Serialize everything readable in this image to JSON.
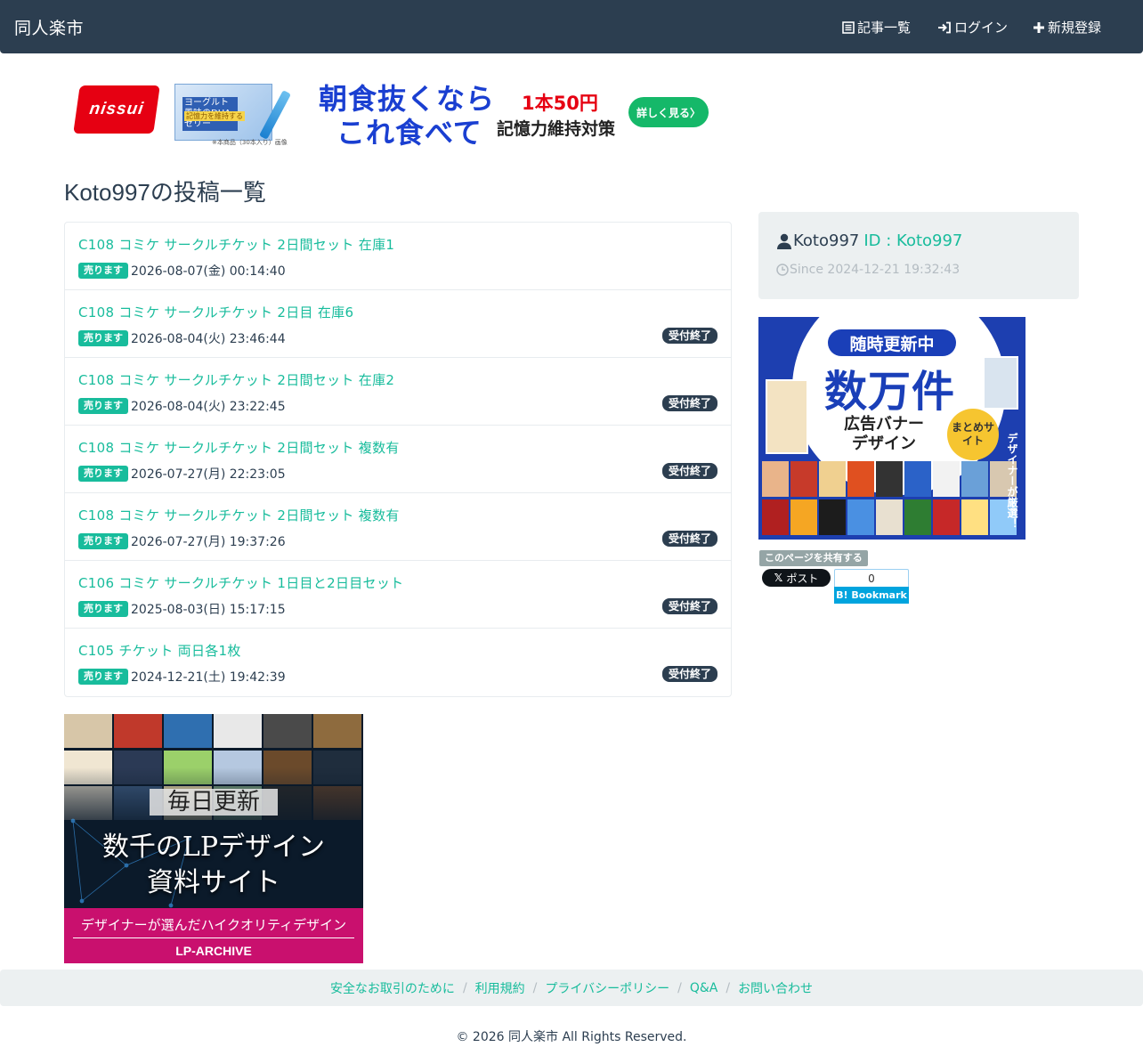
{
  "navbar": {
    "brand": "同人楽市",
    "items": [
      {
        "label": "記事一覧",
        "icon": "list-icon"
      },
      {
        "label": "ログイン",
        "icon": "login-icon"
      },
      {
        "label": "新規登録",
        "icon": "plus-icon"
      }
    ]
  },
  "top_ad": {
    "logo": "nissui",
    "product_label": "ヨーグルト風味のDHAゼリー",
    "product_sub": "記憶力を維持する",
    "product_note": "※本商品（30本入り）画像",
    "headline_line1": "朝食抜くなら",
    "headline_line2": "これ食べて",
    "price": "1本50円",
    "subline": "記憶力維持対策",
    "button": "詳しく見る〉"
  },
  "page_title": "Koto997の投稿一覧",
  "posts": [
    {
      "title": "C108 コミケ サークルチケット 2日間セット 在庫1",
      "type": "売ります",
      "date": "2026-08-07(金) 00:14:40",
      "status": ""
    },
    {
      "title": "C108 コミケ サークルチケット 2日目 在庫6",
      "type": "売ります",
      "date": "2026-08-04(火) 23:46:44",
      "status": "受付終了"
    },
    {
      "title": "C108 コミケ サークルチケット 2日間セット 在庫2",
      "type": "売ります",
      "date": "2026-08-04(火) 23:22:45",
      "status": "受付終了"
    },
    {
      "title": "C108 コミケ サークルチケット 2日間セット 複数有",
      "type": "売ります",
      "date": "2026-07-27(月) 22:23:05",
      "status": "受付終了"
    },
    {
      "title": "C108 コミケ サークルチケット 2日間セット 複数有",
      "type": "売ります",
      "date": "2026-07-27(月) 19:37:26",
      "status": "受付終了"
    },
    {
      "title": "C106 コミケ サークルチケット 1日目と2日目セット",
      "type": "売ります",
      "date": "2025-08-03(日) 15:17:15",
      "status": "受付終了"
    },
    {
      "title": "C105 チケット 両日各1枚",
      "type": "売ります",
      "date": "2024-12-21(土) 19:42:39",
      "status": "受付終了"
    }
  ],
  "profile": {
    "name": "Koto997",
    "id_label": "ID : Koto997",
    "since": "Since 2024-12-21 19:32:43"
  },
  "side_ad": {
    "pill": "随時更新中",
    "big": "数万件",
    "mid_line1": "広告バナー",
    "mid_line2": "デザイン",
    "circle": "まとめサイト",
    "vertical": "デザイナーが厳選！"
  },
  "share": {
    "label": "このページを共有する",
    "x_post": "ポスト",
    "hatena_count": "0",
    "hatena_label": "B! Bookmark"
  },
  "bottom_ad": {
    "line1": "毎日更新",
    "line2": "数千のLPデザイン",
    "line3": "資料サイト",
    "band_line": "デザイナーが選んだハイクオリティデザイン",
    "brand": "LP-ARCHIVE"
  },
  "footer": {
    "links": [
      "安全なお取引のために",
      "利用規約",
      "プライバシーポリシー",
      "Q&A",
      "お問い合わせ"
    ],
    "copyright": "© 2026 同人楽市 All Rights Reserved."
  },
  "colors": {
    "navbar": "#2c3e50",
    "accent": "#18bc9c",
    "panel": "#ecf0f1",
    "muted": "#b4bcc2"
  }
}
